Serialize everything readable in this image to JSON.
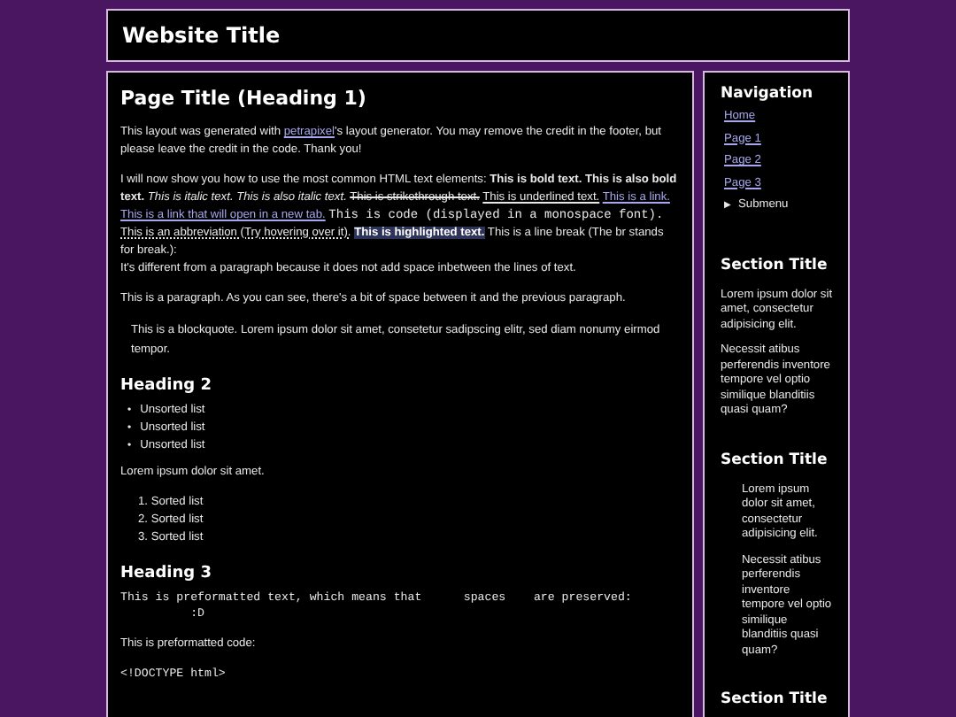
{
  "header": {
    "title": "Website Title"
  },
  "main": {
    "heading": "Page Title (Heading 1)",
    "intro": [
      {
        "kind": "plain",
        "text": "This layout was generated with "
      },
      {
        "kind": "link",
        "text": "petrapixel"
      },
      {
        "kind": "plain",
        "text": "'s layout generator. You may remove the credit in the footer, but please leave the credit in the code. Thank you!"
      }
    ],
    "elements": [
      {
        "kind": "plain",
        "text": "I will now show you how to use the most common HTML text elements: "
      },
      {
        "kind": "bold",
        "text": "This is bold text. This is also bold text."
      },
      {
        "kind": "italic",
        "text": "This is italic text. This is also italic text."
      },
      {
        "kind": "strike",
        "text": "This is strikethrough text."
      },
      {
        "kind": "underline",
        "text": "This is underlined text."
      },
      {
        "kind": "link",
        "text": "This is a link."
      },
      {
        "kind": "link",
        "text": "This is a link that will open in a new tab."
      },
      {
        "kind": "code",
        "text": "This is code (displayed in a monospace font)."
      },
      {
        "kind": "abbr",
        "text": "This is an abbreviation (Try hovering over it)."
      },
      {
        "kind": "mark",
        "text": "This is highlighted text."
      },
      {
        "kind": "plain",
        "text": "This is a line break (The br stands for break.):"
      },
      {
        "kind": "break"
      },
      {
        "kind": "plain",
        "text": "It's different from a paragraph because it does not add space inbetween the lines of text."
      }
    ],
    "paragraph": "This is a paragraph. As you can see, there's a bit of space between it and the previous paragraph.",
    "blockquote": "This is a blockquote. Lorem ipsum dolor sit amet, consetetur sadipscing elitr, sed diam nonumy eirmod tempor.",
    "heading2": "Heading 2",
    "unsorted_list": [
      {
        "marker": "•",
        "text": "Unsorted list"
      },
      {
        "marker": "•",
        "text": "Unsorted list"
      },
      {
        "marker": "•",
        "text": "Unsorted list"
      }
    ],
    "lorem": "Lorem ipsum dolor sit amet.",
    "sorted_list": [
      {
        "number": "1.",
        "text": "Sorted list"
      },
      {
        "number": "2.",
        "text": "Sorted list"
      },
      {
        "number": "3.",
        "text": "Sorted list"
      }
    ],
    "heading3": "Heading 3",
    "preformatted": "This is preformatted text, which means that      spaces    are preserved:\n          :D",
    "code_label": "This is preformatted code:",
    "code": "<!DOCTYPE html>"
  },
  "sidebar": {
    "nav_title": "Navigation",
    "nav_items": [
      {
        "label": "Home"
      },
      {
        "label": "Page 1"
      },
      {
        "label": "Page 2"
      },
      {
        "label": "Page 3"
      }
    ],
    "submenu": {
      "marker": "▶",
      "label": "Submenu"
    },
    "sections": [
      {
        "title": "Section Title",
        "indented": false,
        "paragraphs": [
          "Lorem ipsum dolor sit amet, consectetur adipisicing elit.",
          "Necessit atibus perferendis inventore tempore vel optio similique blanditiis quasi quam?"
        ]
      },
      {
        "title": "Section Title",
        "indented": true,
        "paragraphs": [
          "Lorem ipsum dolor sit amet, consectetur adipisicing elit.",
          "Necessit atibus perferendis inventore tempore vel optio similique blanditiis quasi quam?"
        ]
      },
      {
        "title": "Section Title"
      }
    ]
  }
}
